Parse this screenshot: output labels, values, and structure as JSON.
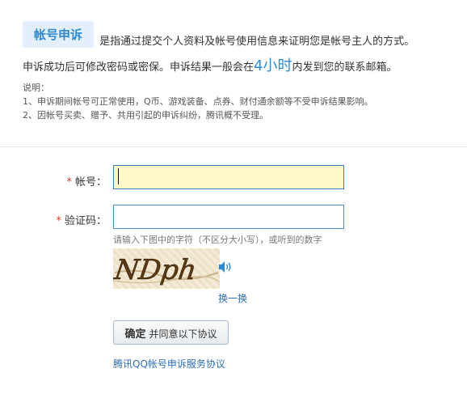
{
  "intro": {
    "badge": "帐号申诉",
    "line1": "是指通过提交个人资料及帐号使用信息来证明您是帐号主人的方式。",
    "line2_before": "申诉成功后可修改密码或密保。申诉结果一般会在",
    "line2_highlight": "4小时",
    "line2_after": "内发到您的联系邮箱。"
  },
  "notes": {
    "title": "说明：",
    "items": [
      "1、申诉期间帐号可正常使用，Q币、游戏装备、点券、财付通余额等不受申诉结果影响。",
      "2、因帐号买卖、赠予、共用引起的申诉纠纷，腾讯概不受理。"
    ]
  },
  "form": {
    "required_mark": "*",
    "account_label": "帐号：",
    "account_value": "",
    "captcha_label": "验证码：",
    "captcha_value": "",
    "captcha_hint": "请输入下图中的字符（不区分大小写），或听到的数字",
    "captcha_text": "NDph",
    "refresh_label": "换一换",
    "submit_main": "确定",
    "submit_sub": "并同意以下协议",
    "agreement_link": "腾讯QQ帐号申诉服务协议"
  },
  "colors": {
    "accent": "#2d8ad6",
    "required": "#d43b2e",
    "input_highlight": "#fff8c9",
    "link": "#2d6fb4"
  }
}
